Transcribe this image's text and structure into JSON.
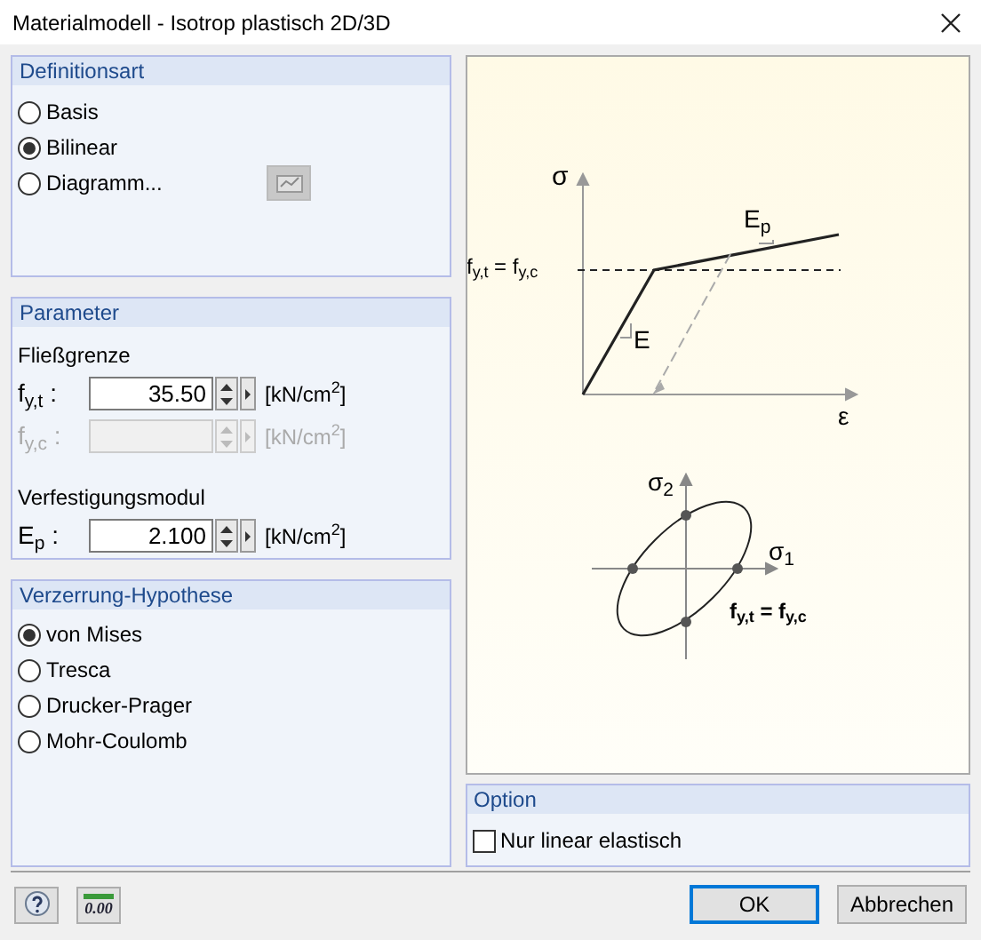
{
  "window": {
    "title": "Materialmodell - Isotrop plastisch 2D/3D"
  },
  "definitionsart": {
    "title": "Definitionsart",
    "options": [
      {
        "label": "Basis",
        "selected": false
      },
      {
        "label": "Bilinear",
        "selected": true
      },
      {
        "label": "Diagramm...",
        "selected": false
      }
    ]
  },
  "parameter": {
    "title": "Parameter",
    "groups": [
      {
        "heading": "Fließgrenze",
        "fields": [
          {
            "label": "f$_{y,t}$ :",
            "value": "35.50",
            "unit": "[kN/cm$^{2}$]",
            "disabled": false
          },
          {
            "label": "f$_{y,c}$ :",
            "unit": "[kN/cm$^{2}$]",
            "disabled": true
          }
        ]
      },
      {
        "heading": "Verfestigungsmodul",
        "fields": [
          {
            "label": "E$_{p}$ :",
            "value": "2.100",
            "unit": "[kN/cm$^{2}$]",
            "disabled": false
          }
        ]
      }
    ]
  },
  "hypothese": {
    "title": "Verzerrung-Hypothese",
    "options": [
      {
        "label": "von Mises",
        "selected": true
      },
      {
        "label": "Tresca",
        "selected": false
      },
      {
        "label": "Drucker-Prager",
        "selected": false
      },
      {
        "label": "Mohr-Coulomb",
        "selected": false
      }
    ]
  },
  "diagram": {
    "labels": [
      "σ",
      "E$_{p}$",
      "f$_{y,t}$ = f$_{y,c}$",
      "E",
      "ε",
      "σ$_{2}$",
      "σ$_{1}$",
      "**f$_{y,t}$ = f$_{y,c}$**"
    ]
  },
  "option": {
    "title": "Option",
    "items": [
      {
        "label": "Nur linear elastisch",
        "checked": false
      }
    ]
  },
  "footer": {
    "icon_text": "0.00",
    "buttons": [
      "OK",
      "Abbrechen"
    ]
  }
}
